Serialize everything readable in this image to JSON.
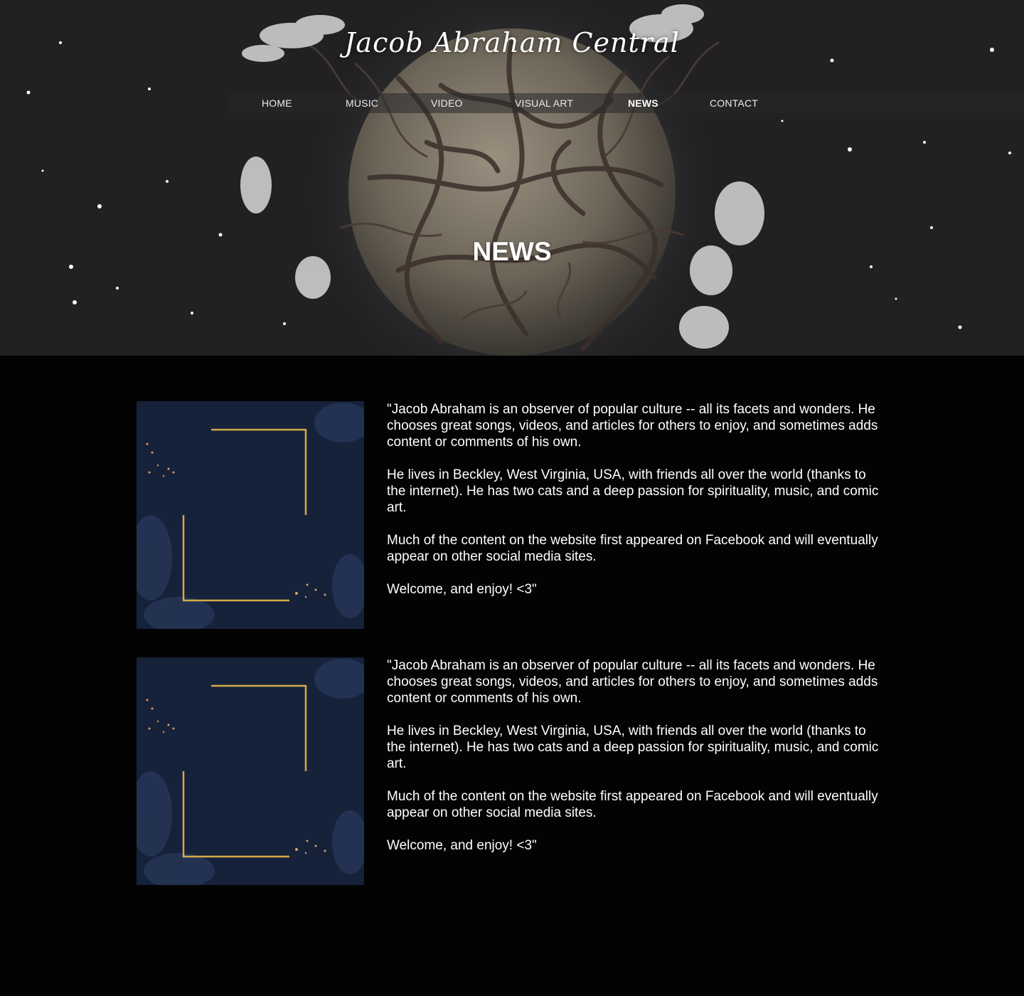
{
  "site": {
    "title": "Jacob Abraham Central"
  },
  "nav": {
    "items": [
      {
        "label": "HOME"
      },
      {
        "label": "MUSIC"
      },
      {
        "label": "VIDEO"
      },
      {
        "label": "VISUAL ART"
      },
      {
        "label": "NEWS",
        "active": true
      },
      {
        "label": "CONTACT"
      }
    ]
  },
  "hero": {
    "heading": "NEWS"
  },
  "posts": [
    {
      "paragraphs": [
        "\"Jacob Abraham is an observer of popular culture -- all its facets and wonders. He chooses great songs, videos, and articles for others to enjoy, and sometimes adds content or comments of his own.",
        "He lives in Beckley, West Virginia, USA, with friends all over the world (thanks to the internet). He has two cats and a deep passion for spirituality, music, and comic art.",
        "Much of the content on the website first appeared on Facebook and will eventually appear on other social media sites.",
        "Welcome, and enjoy! <3\""
      ]
    },
    {
      "paragraphs": [
        "\"Jacob Abraham is an observer of popular culture -- all its facets and wonders. He chooses great songs, videos, and articles for others to enjoy, and sometimes adds content or comments of his own.",
        "He lives in Beckley, West Virginia, USA, with friends all over the world (thanks to the internet). He has two cats and a deep passion for spirituality, music, and comic art.",
        "Much of the content on the website first appeared on Facebook and will eventually appear on other social media sites.",
        "Welcome, and enjoy! <3\""
      ]
    }
  ],
  "colors": {
    "page_background": "#030303",
    "hero_background": "#212022",
    "thumb_navy": "#16213a",
    "thumb_gold": "#d4a94a"
  }
}
